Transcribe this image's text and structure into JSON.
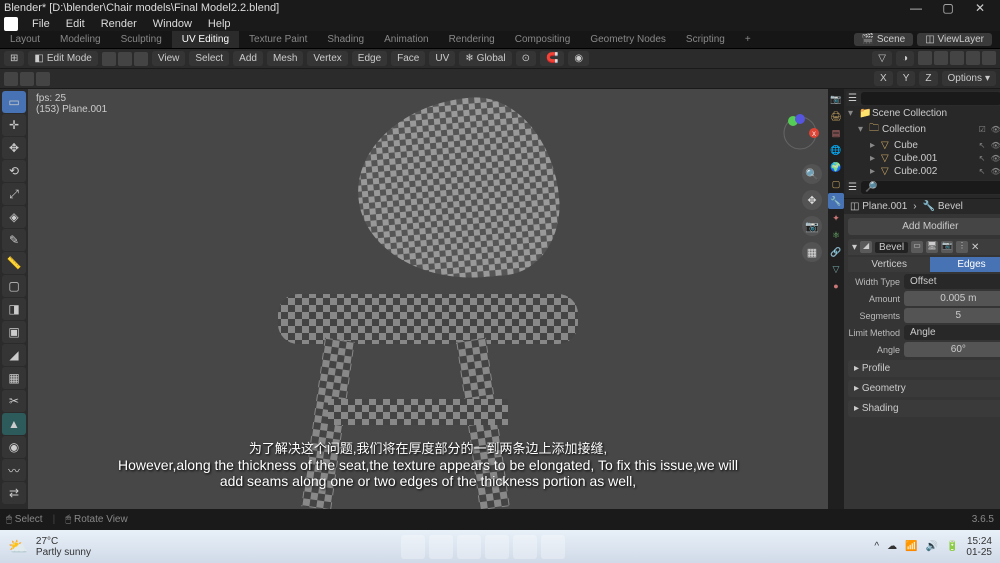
{
  "title": "Blender* [D:\\blender\\Chair models\\Final Model2.2.blend]",
  "menu": [
    "File",
    "Edit",
    "Render",
    "Window",
    "Help"
  ],
  "workspaces": [
    "Layout",
    "Modeling",
    "Sculpting",
    "UV Editing",
    "Texture Paint",
    "Shading",
    "Animation",
    "Rendering",
    "Compositing",
    "Geometry Nodes",
    "Scripting"
  ],
  "workspace_active": "UV Editing",
  "ws_scene": "Scene",
  "ws_viewlayer": "ViewLayer",
  "toolheader": {
    "mode": "Edit Mode",
    "menus": [
      "View",
      "Select",
      "Add",
      "Mesh",
      "Vertex",
      "Edge",
      "Face",
      "UV"
    ],
    "orientation": "Global",
    "options": "Options"
  },
  "viewport": {
    "fps": "fps: 25",
    "object": "(153) Plane.001",
    "axes": [
      "X",
      "Y",
      "Z"
    ]
  },
  "outliner": {
    "root": "Scene Collection",
    "collection": "Collection",
    "items": [
      "Cube",
      "Cube.001",
      "Cube.002"
    ],
    "search_placeholder": ""
  },
  "breadcrumb": {
    "a": "Plane.001",
    "b": "Bevel"
  },
  "props": {
    "add": "Add Modifier",
    "mod_name": "Bevel",
    "tab_vertices": "Vertices",
    "tab_edges": "Edges",
    "width_type_label": "Width Type",
    "width_type": "Offset",
    "amount_label": "Amount",
    "amount": "0.005 m",
    "segments_label": "Segments",
    "segments": "5",
    "limit_label": "Limit Method",
    "limit": "Angle",
    "angle_label": "Angle",
    "angle": "60°",
    "sections": [
      "Profile",
      "Geometry",
      "Shading"
    ]
  },
  "status": {
    "mouse": "Select",
    "mmb": "Rotate View",
    "version": "3.6.5"
  },
  "subtitle_cn": "为了解决这个问题,我们将在厚度部分的一到两条边上添加接缝,",
  "subtitle_en": "However,along the thickness of the seat,the texture appears to be elongated, To fix this issue,we will add seams along one or two edges of the thickness portion as well,",
  "taskbar": {
    "temp": "27°C",
    "weather": "Partly sunny",
    "time": "15:24",
    "date": "01-25"
  }
}
